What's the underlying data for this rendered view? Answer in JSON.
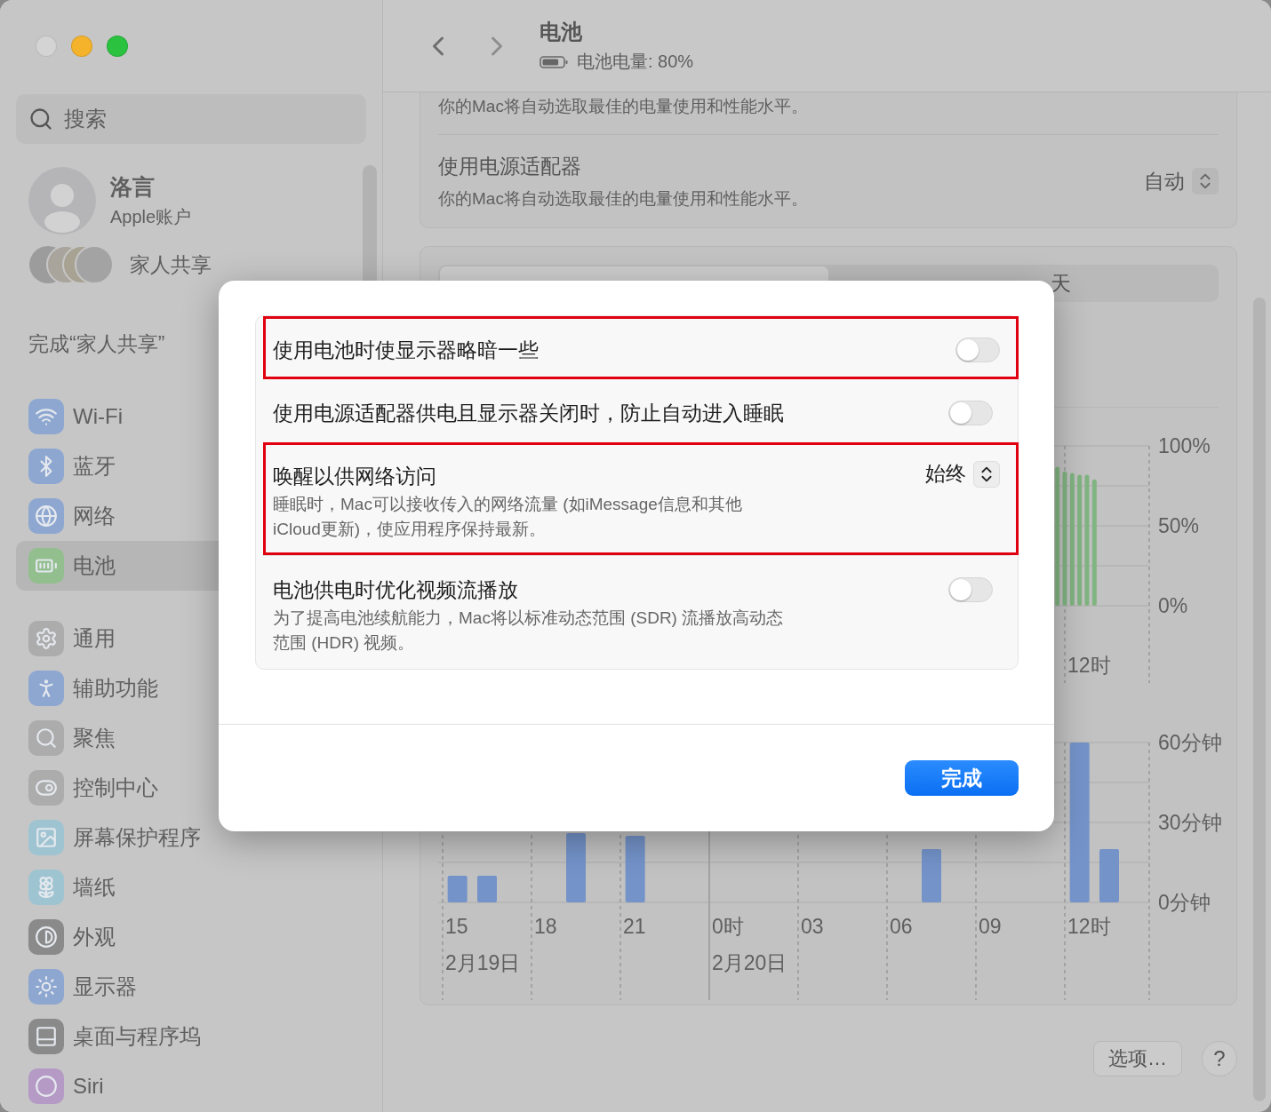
{
  "sidebar": {
    "search": {
      "placeholder": "搜索"
    },
    "account": {
      "name": "洛言",
      "subtitle": "Apple账户"
    },
    "family": {
      "label": "家人共享"
    },
    "setup_notice": "完成“家人共享”",
    "groups": [
      [
        {
          "label": "Wi-Fi",
          "color": "#8ea7d1",
          "selected": false
        },
        {
          "label": "蓝牙",
          "color": "#8ea7d1",
          "selected": false
        },
        {
          "label": "网络",
          "color": "#8ea7d1",
          "selected": false
        },
        {
          "label": "电池",
          "color": "#93bf8f",
          "selected": true
        }
      ],
      [
        {
          "label": "通用",
          "color": "#acacac",
          "selected": false
        },
        {
          "label": "辅助功能",
          "color": "#8ea7d1",
          "selected": false
        },
        {
          "label": "聚焦",
          "color": "#acacac",
          "selected": false
        },
        {
          "label": "控制中心",
          "color": "#acacac",
          "selected": false
        },
        {
          "label": "屏幕保护程序",
          "color": "#9fc4d1",
          "selected": false
        },
        {
          "label": "墙纸",
          "color": "#9fc4d1",
          "selected": false
        },
        {
          "label": "外观",
          "color": "#8a8a8a",
          "selected": false
        },
        {
          "label": "显示器",
          "color": "#8ea7d1",
          "selected": false
        },
        {
          "label": "桌面与程序坞",
          "color": "#8a8a8a",
          "selected": false
        },
        {
          "label": "Siri",
          "color": "#b49ac4",
          "selected": false
        }
      ]
    ]
  },
  "header": {
    "title": "电池",
    "battery_status": "电池电量: 80%"
  },
  "power_card": {
    "top_description": "你的Mac将自动选取最佳的电量使用和性能水平。",
    "row": {
      "title": "使用电源适配器",
      "description": "你的Mac将自动选取最佳的电量使用和性能水平。",
      "value": "自动"
    }
  },
  "usage": {
    "tabs": [
      {
        "selected": true
      },
      {
        "label": "天",
        "selected": false
      }
    ],
    "level_chart": {
      "axis_labels": [
        "100%",
        "50%",
        "0%"
      ],
      "time_label": "12时"
    },
    "activity_chart": {
      "chart_data": {
        "type": "bar",
        "values": [
          10,
          10,
          null,
          null,
          26,
          null,
          25,
          null,
          null,
          null,
          null,
          null,
          null,
          null,
          null,
          null,
          20,
          null,
          null,
          null,
          null,
          60,
          20,
          null
        ],
        "ylim": [
          0,
          60
        ],
        "yticks": [
          {
            "value": 60,
            "label": "60分钟"
          },
          {
            "value": 30,
            "label": "30分钟"
          },
          {
            "value": 0,
            "label": "0分钟"
          }
        ],
        "annotations": [
          "15",
          "18",
          "21",
          "0时",
          "03",
          "06",
          "09",
          "12时",
          "2月19日",
          "2月20日"
        ]
      }
    }
  },
  "footer_buttons": {
    "options": "选项…",
    "help": "?"
  },
  "dialog": {
    "rows": [
      {
        "kind": "toggle",
        "title": "使用电池时使显示器略暗一些",
        "on": false,
        "highlighted": true
      },
      {
        "kind": "toggle",
        "title": "使用电源适配器供电且显示器关闭时，防止自动进入睡眠",
        "on": false,
        "highlighted": false
      },
      {
        "kind": "popup",
        "title": "唤醒以供网络访问",
        "description": "睡眠时，Mac可以接收传入的网络流量 (如iMessage信息和其他iCloud更新)，使应用程序保持最新。",
        "value": "始终",
        "highlighted": true
      },
      {
        "kind": "toggle",
        "title": "电池供电时优化视频流播放",
        "description": "为了提高电池续航能力，Mac将以标准动态范围 (SDR) 流播放高动态范围 (HDR) 视频。",
        "on": false,
        "highlighted": false
      }
    ],
    "done_button": "完成"
  }
}
